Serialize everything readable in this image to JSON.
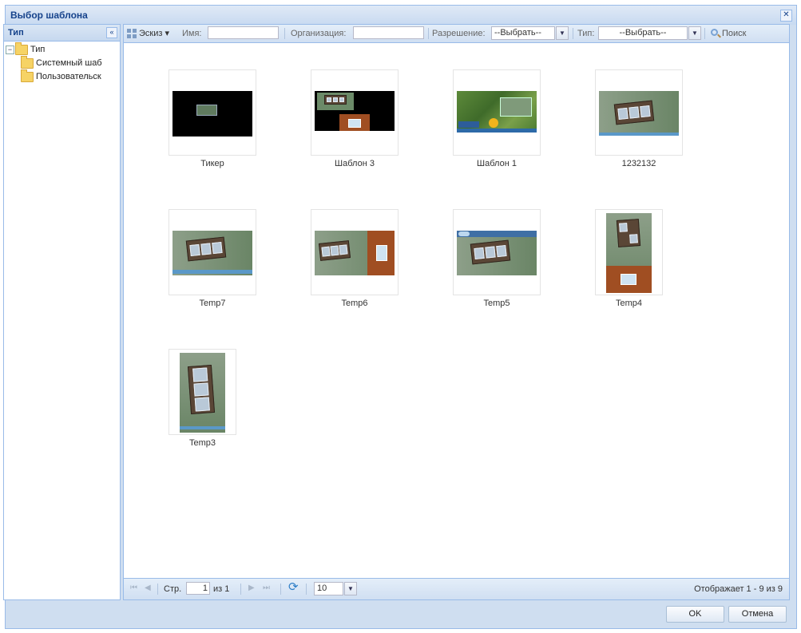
{
  "window": {
    "title": "Выбор шаблона",
    "close_glyph": "✕"
  },
  "west_panel": {
    "title": "Тип",
    "collapse_glyph": "«",
    "tree": {
      "root": {
        "toggle": "−",
        "label": "Тип"
      },
      "children": [
        "Системный шаб",
        "Пользовательск"
      ]
    }
  },
  "toolbar": {
    "view_mode": "Эскиз",
    "view_arrow": "▾",
    "name_label": "Имя:",
    "name_value": "",
    "org_label": "Организация:",
    "org_value": "",
    "resolution_label": "Разрешение:",
    "resolution_value": "--Выбрать--",
    "type_label": "Тип:",
    "type_value": "--Выбрать--",
    "combo_arrow": "▼",
    "search_label": "Поиск"
  },
  "templates": [
    {
      "name": "Тикер",
      "kind": "ticker"
    },
    {
      "name": "Шаблон 3",
      "kind": "split"
    },
    {
      "name": "Шаблон 1",
      "kind": "nature"
    },
    {
      "name": "1232132",
      "kind": "film"
    },
    {
      "name": "Temp7",
      "kind": "film-bar"
    },
    {
      "name": "Temp6",
      "kind": "film-side"
    },
    {
      "name": "Temp5",
      "kind": "film-top"
    },
    {
      "name": "Temp4",
      "kind": "portrait-split"
    },
    {
      "name": "Temp3",
      "kind": "portrait"
    }
  ],
  "pager": {
    "first": "⏮",
    "prev": "◀",
    "page_label": "Стр.",
    "page_value": "1",
    "of_label": "из 1",
    "next": "▶",
    "last": "⏭",
    "refresh": "⟳",
    "page_size": "10",
    "size_arrow": "▼",
    "status": "Отображает 1 - 9 из 9"
  },
  "buttons": {
    "ok": "OK",
    "cancel": "Отмена"
  },
  "colors": {
    "accent": "#15428b",
    "border": "#99bbe8",
    "panel_bg": "#cfdef0",
    "thumb_green": "#6e8a6a",
    "thumb_rust": "#a04e22"
  }
}
